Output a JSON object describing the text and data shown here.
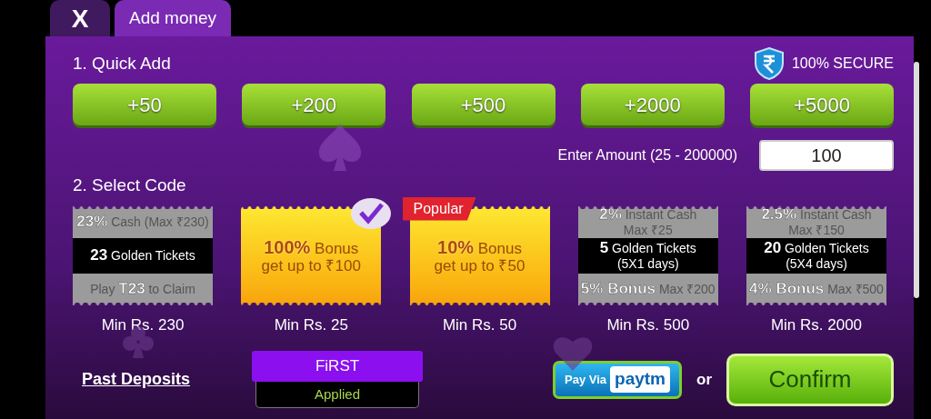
{
  "tabs": [
    {
      "label": "X",
      "selected": false
    },
    {
      "label": "Add money",
      "selected": true
    }
  ],
  "secure": {
    "label": "100% SECURE"
  },
  "quick_add": {
    "title": "1. Quick Add",
    "buttons": [
      "+50",
      "+200",
      "+500",
      "+2000",
      "+5000"
    ]
  },
  "amount": {
    "label": "Enter Amount (25 - 200000)",
    "value": "100"
  },
  "select_code": {
    "title": "2. Select Code",
    "codes": [
      {
        "kind": "tickets",
        "selected": false,
        "top": [
          "**23%** Cash (Max ₹230)"
        ],
        "middle": [
          "**23** Golden Tickets"
        ],
        "bottom": [
          "Play **T23** to Claim"
        ],
        "min": "Min Rs. 230"
      },
      {
        "kind": "bonus",
        "selected": true,
        "lines": [
          "**100%** Bonus",
          "get up to ₹100"
        ],
        "min": "Min Rs. 25"
      },
      {
        "kind": "bonus",
        "selected": false,
        "tag": "Popular",
        "lines": [
          "**10%** Bonus",
          "get up to ₹50"
        ],
        "min": "Min Rs. 50"
      },
      {
        "kind": "tickets",
        "selected": false,
        "top": [
          "**2%** Instant Cash",
          "Max ₹25"
        ],
        "middle": [
          "**5** Golden Tickets",
          "(5X1 days)"
        ],
        "bottom": [
          "**5% Bonus** Max ₹200"
        ],
        "min": "Min Rs. 500"
      },
      {
        "kind": "tickets",
        "selected": false,
        "top": [
          "**2.5%** Instant Cash",
          "Max ₹150"
        ],
        "middle": [
          "**20** Golden Tickets",
          "(5X4 days)"
        ],
        "bottom": [
          "**4% Bonus** Max ₹500"
        ],
        "min": "Min Rs. 2000"
      }
    ]
  },
  "past_deposits": "Past Deposits",
  "applied_code": {
    "code": "FiRST",
    "status": "Applied"
  },
  "paytm": {
    "prefix": "Pay Via",
    "brand": "paytm"
  },
  "or": "or",
  "confirm": "Confirm"
}
